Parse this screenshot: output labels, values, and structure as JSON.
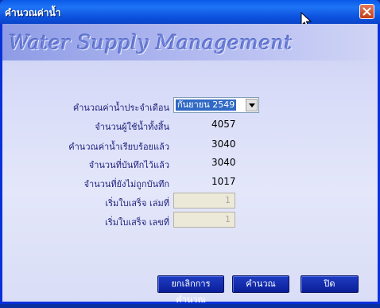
{
  "window": {
    "title": "คำนวณค่าน้ำ"
  },
  "banner": {
    "title": "Water Supply Management"
  },
  "form": {
    "month_label": "คำนวณค่าน้ำประจำเดือน",
    "month_value": "กันยายน 2549",
    "total_users_label": "จำนวนผู้ใช้น้ำทั้งสิ้น",
    "total_users_value": "4057",
    "calculated_label": "คำนวณค่าน้ำเรียบร้อยแล้ว",
    "calculated_value": "3040",
    "saved_label": "จำนวนที่บันทึกไว้แล้ว",
    "saved_value": "3040",
    "unsaved_label": "จำนวนที่ยังไม่ถูกบันทึก",
    "unsaved_value": "1017",
    "receipt_book_label": "เริ่มใบเสร็จ เล่มที่",
    "receipt_book_value": "1",
    "receipt_number_label": "เริ่มใบเสร็จ เลขที่",
    "receipt_number_value": "1"
  },
  "buttons": {
    "cancel_label": "ยกเลิกการคำนวณ",
    "calculate_label": "คำนวณ",
    "close_label": "ปิด"
  },
  "icons": {
    "close": "close-icon",
    "dropdown": "chevron-down-icon",
    "cursor": "mouse-pointer-icon"
  },
  "colors": {
    "titlebar": "#0a5ae8",
    "label_text": "#1d1f7a",
    "button": "#1f3cc2",
    "selection": "#316ac5"
  }
}
